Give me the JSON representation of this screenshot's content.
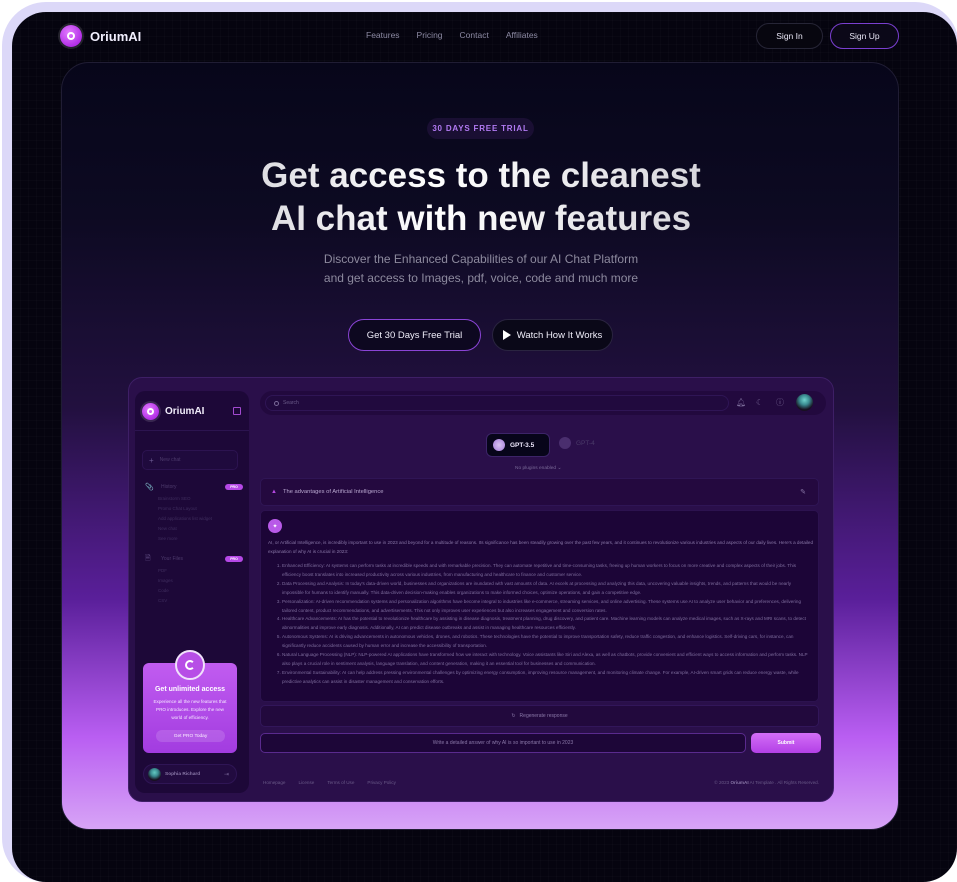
{
  "nav": {
    "brand": "OriumAI",
    "links": [
      "Features",
      "Pricing",
      "Contact",
      "Affiliates"
    ],
    "sign_in": "Sign In",
    "sign_up": "Sign Up"
  },
  "hero": {
    "badge": "30 DAYS FREE TRIAL",
    "title_line1": "Get access to the cleanest",
    "title_line2": "AI chat with new features",
    "subtitle_line1": "Discover the Enhanced Capabilities of our AI Chat Platform",
    "subtitle_line2": "and get access to Images, pdf, voice, code and much more",
    "cta_primary": "Get 30 Days Free Trial",
    "cta_secondary": "Watch How It Works"
  },
  "app": {
    "sidebar": {
      "brand": "OriumAI",
      "new_chat": "New chat",
      "history": {
        "label": "History",
        "badge": "PRO",
        "items": [
          "Brainstorm SEO",
          "Promo Chat Layout",
          "Add applications list widget",
          "New chat",
          "See more"
        ]
      },
      "files": {
        "label": "Your Files",
        "badge": "PRO",
        "items": [
          "PDF",
          "Images",
          "Code",
          "CSV"
        ]
      },
      "promo": {
        "title": "Get unlimited access",
        "description": "Experience all the new features that PRO introduces. Explore the new world of efficiency.",
        "button": "Get PRO Today"
      },
      "user": {
        "name": "Sophia Richard"
      }
    },
    "topbar": {
      "search_placeholder": "Search"
    },
    "models": {
      "active": "GPT-3.5",
      "inactive": "GPT-4",
      "plugins": "No plugins enabled"
    },
    "question": "The advantages of Artificial Intelligence",
    "answer": {
      "intro": "AI, or Artificial Intelligence, is incredibly important to use in 2023 and beyond for a multitude of reasons. Its significance has been steadily growing over the past few years, and it continues to revolutionize various industries and aspects of our daily lives. Here's a detailed explanation of why AI is crucial in 2023:",
      "points": [
        "Enhanced Efficiency: AI systems can perform tasks at incredible speeds and with remarkable precision. They can automate repetitive and time-consuming tasks, freeing up human workers to focus on more creative and complex aspects of their jobs. This efficiency boost translates into increased productivity across various industries, from manufacturing and healthcare to finance and customer service.",
        "Data Processing and Analysis: In today's data-driven world, businesses and organizations are inundated with vast amounts of data. AI excels at processing and analyzing this data, uncovering valuable insights, trends, and patterns that would be nearly impossible for humans to identify manually. This data-driven decision-making enables organizations to make informed choices, optimize operations, and gain a competitive edge.",
        "Personalization: AI-driven recommendation systems and personalization algorithms have become integral to industries like e-commerce, streaming services, and online advertising. These systems use AI to analyze user behavior and preferences, delivering tailored content, product recommendations, and advertisements. This not only improves user experiences but also increases engagement and conversion rates.",
        "Healthcare Advancements: AI has the potential to revolutionize healthcare by assisting in disease diagnosis, treatment planning, drug discovery, and patient care. Machine learning models can analyze medical images, such as X-rays and MRI scans, to detect abnormalities and improve early diagnosis. Additionally, AI can predict disease outbreaks and assist in managing healthcare resources efficiently.",
        "Autonomous Systems: AI is driving advancements in autonomous vehicles, drones, and robotics. These technologies have the potential to improve transportation safety, reduce traffic congestion, and enhance logistics. Self-driving cars, for instance, can significantly reduce accidents caused by human error and increase the accessibility of transportation.",
        "Natural Language Processing (NLP): NLP-powered AI applications have transformed how we interact with technology. Voice assistants like Siri and Alexa, as well as chatbots, provide convenient and efficient ways to access information and perform tasks. NLP also plays a crucial role in sentiment analysis, language translation, and content generation, making it an essential tool for businesses and communication.",
        "Environmental Sustainability: AI can help address pressing environmental challenges by optimizing energy consumption, improving resource management, and monitoring climate change. For example, AI-driven smart grids can reduce energy waste, while predictive analytics can assist in disaster management and conservation efforts."
      ]
    },
    "regenerate": "Regenerate response",
    "prompt_value": "Write a detailed answer of why AI is so important to use in 2023",
    "submit": "Submit",
    "footer": {
      "links": [
        "Homepage",
        "License",
        "Terms of Use",
        "Privacy Policy"
      ],
      "copyright_prefix": "© 2023",
      "copyright_brand": "OriumAI",
      "copyright_suffix": "AI Template . All Rights Reserved."
    }
  },
  "colors": {
    "accent": "#b548e6",
    "page_bg": "#05040f",
    "frame": "#dcd8f8"
  }
}
